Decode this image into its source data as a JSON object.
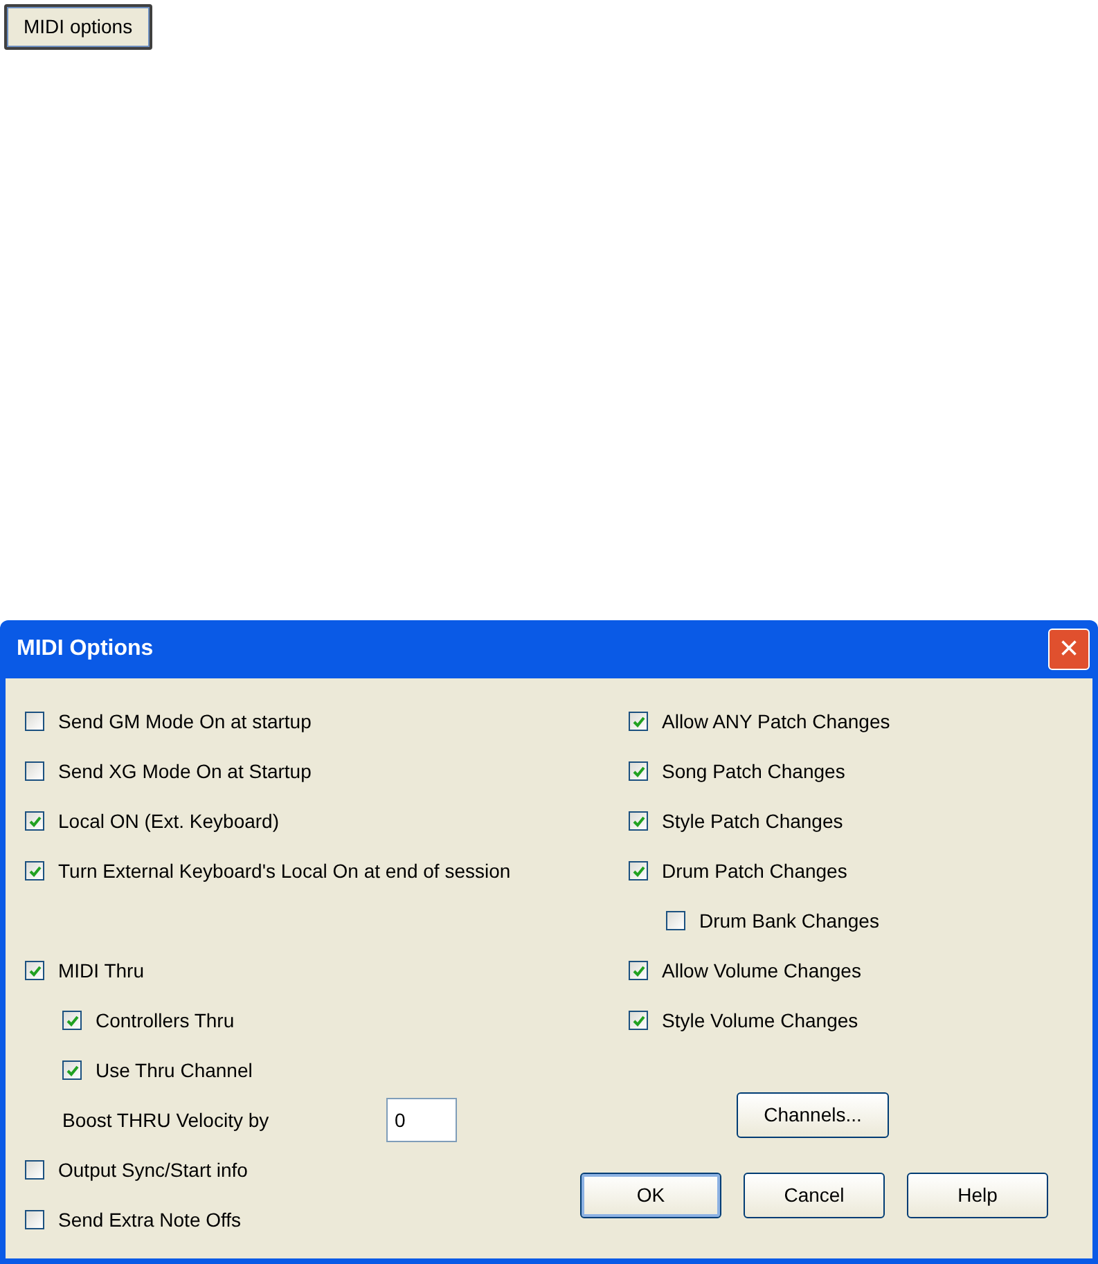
{
  "top_button": "MIDI options",
  "window": {
    "title": "MIDI Options",
    "close": "×"
  },
  "left_sections": [
    [
      {
        "kind": "checkbox",
        "label": "Send GM Mode On at startup",
        "checked": false
      },
      {
        "kind": "checkbox",
        "label": "Send XG Mode On at Startup",
        "checked": false
      },
      {
        "kind": "checkbox",
        "label": "Local ON (Ext. Keyboard)",
        "checked": true
      },
      {
        "kind": "checkbox",
        "label": "Turn External Keyboard's Local On at end of session",
        "checked": true
      }
    ],
    [
      {
        "kind": "checkbox",
        "label": "MIDI Thru",
        "checked": true,
        "children": [
          {
            "kind": "checkbox",
            "label": "Controllers Thru",
            "checked": true
          },
          {
            "kind": "checkbox",
            "label": "Use Thru Channel",
            "checked": true
          },
          {
            "kind": "number",
            "label": "Boost THRU Velocity by",
            "value": "0"
          }
        ]
      },
      {
        "kind": "checkbox",
        "label": "Output Sync/Start info",
        "checked": false
      },
      {
        "kind": "checkbox",
        "label": "Send Extra Note Offs",
        "checked": false
      }
    ]
  ],
  "right_items": [
    {
      "kind": "checkbox",
      "label": "Allow ANY Patch Changes",
      "checked": true
    },
    {
      "kind": "checkbox",
      "label": "Song Patch Changes",
      "checked": true
    },
    {
      "kind": "checkbox",
      "label": "Style Patch Changes",
      "checked": true
    },
    {
      "kind": "checkbox",
      "label": "Drum Patch Changes",
      "checked": true,
      "children": [
        {
          "kind": "checkbox",
          "label": "Drum Bank Changes",
          "checked": false
        }
      ]
    },
    {
      "kind": "checkbox",
      "label": "Allow Volume Changes",
      "checked": true
    },
    {
      "kind": "checkbox",
      "label": "Style Volume Changes",
      "checked": true
    }
  ],
  "channels_button": "Channels...",
  "buttons": [
    {
      "label": "OK",
      "default": true
    },
    {
      "label": "Cancel",
      "default": false
    },
    {
      "label": "Help",
      "default": false
    }
  ]
}
